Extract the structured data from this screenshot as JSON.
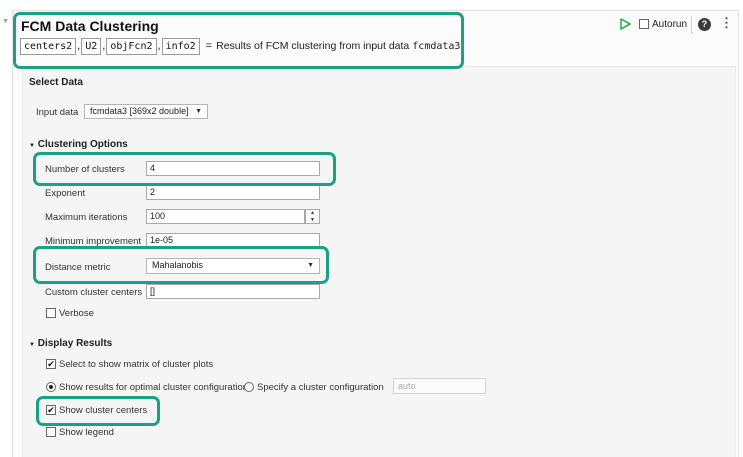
{
  "header": {
    "title": "FCM Data Clustering",
    "outputs": [
      "centers2",
      "U2",
      "objFcn2",
      "info2"
    ],
    "separator": ",",
    "equals": "=",
    "description": "Results of FCM clustering from input data",
    "input_var": "fcmdata3",
    "autorun_label": "Autorun",
    "help_glyph": "?",
    "more_glyph": "⋮"
  },
  "select_data": {
    "heading": "Select Data",
    "input_label": "Input data",
    "input_value": "fcmdata3 [369x2 double]"
  },
  "clustering": {
    "heading": "Clustering Options",
    "num_clusters_label": "Number of clusters",
    "num_clusters_value": "4",
    "exponent_label": "Exponent",
    "exponent_value": "2",
    "max_iter_label": "Maximum iterations",
    "max_iter_value": "100",
    "min_improve_label": "Minimum improvement",
    "min_improve_value": "1e-05",
    "distance_label": "Distance metric",
    "distance_value": "Mahalanobis",
    "custom_centers_label": "Custom cluster centers",
    "custom_centers_value": "[]",
    "verbose_label": "Verbose",
    "verbose_checked": false
  },
  "display": {
    "heading": "Display Results",
    "matrix_label": "Select to show matrix of cluster plots",
    "matrix_checked": true,
    "optimal_label": "Show results for optimal cluster configuration",
    "optimal_selected": true,
    "specify_label": "Specify a cluster configuration",
    "specify_value": "auto",
    "centers_label": "Show cluster centers",
    "centers_checked": true,
    "legend_label": "Show legend",
    "legend_checked": false
  },
  "colors": {
    "callout": "#18a283",
    "run_icon": "#2fb24c"
  },
  "icons": [
    "run-icon",
    "help-icon",
    "more-options-icon",
    "dropdown-arrow-icon",
    "collapse-caret-icon",
    "spinner-up-icon",
    "spinner-down-icon",
    "checkmark-icon"
  ]
}
